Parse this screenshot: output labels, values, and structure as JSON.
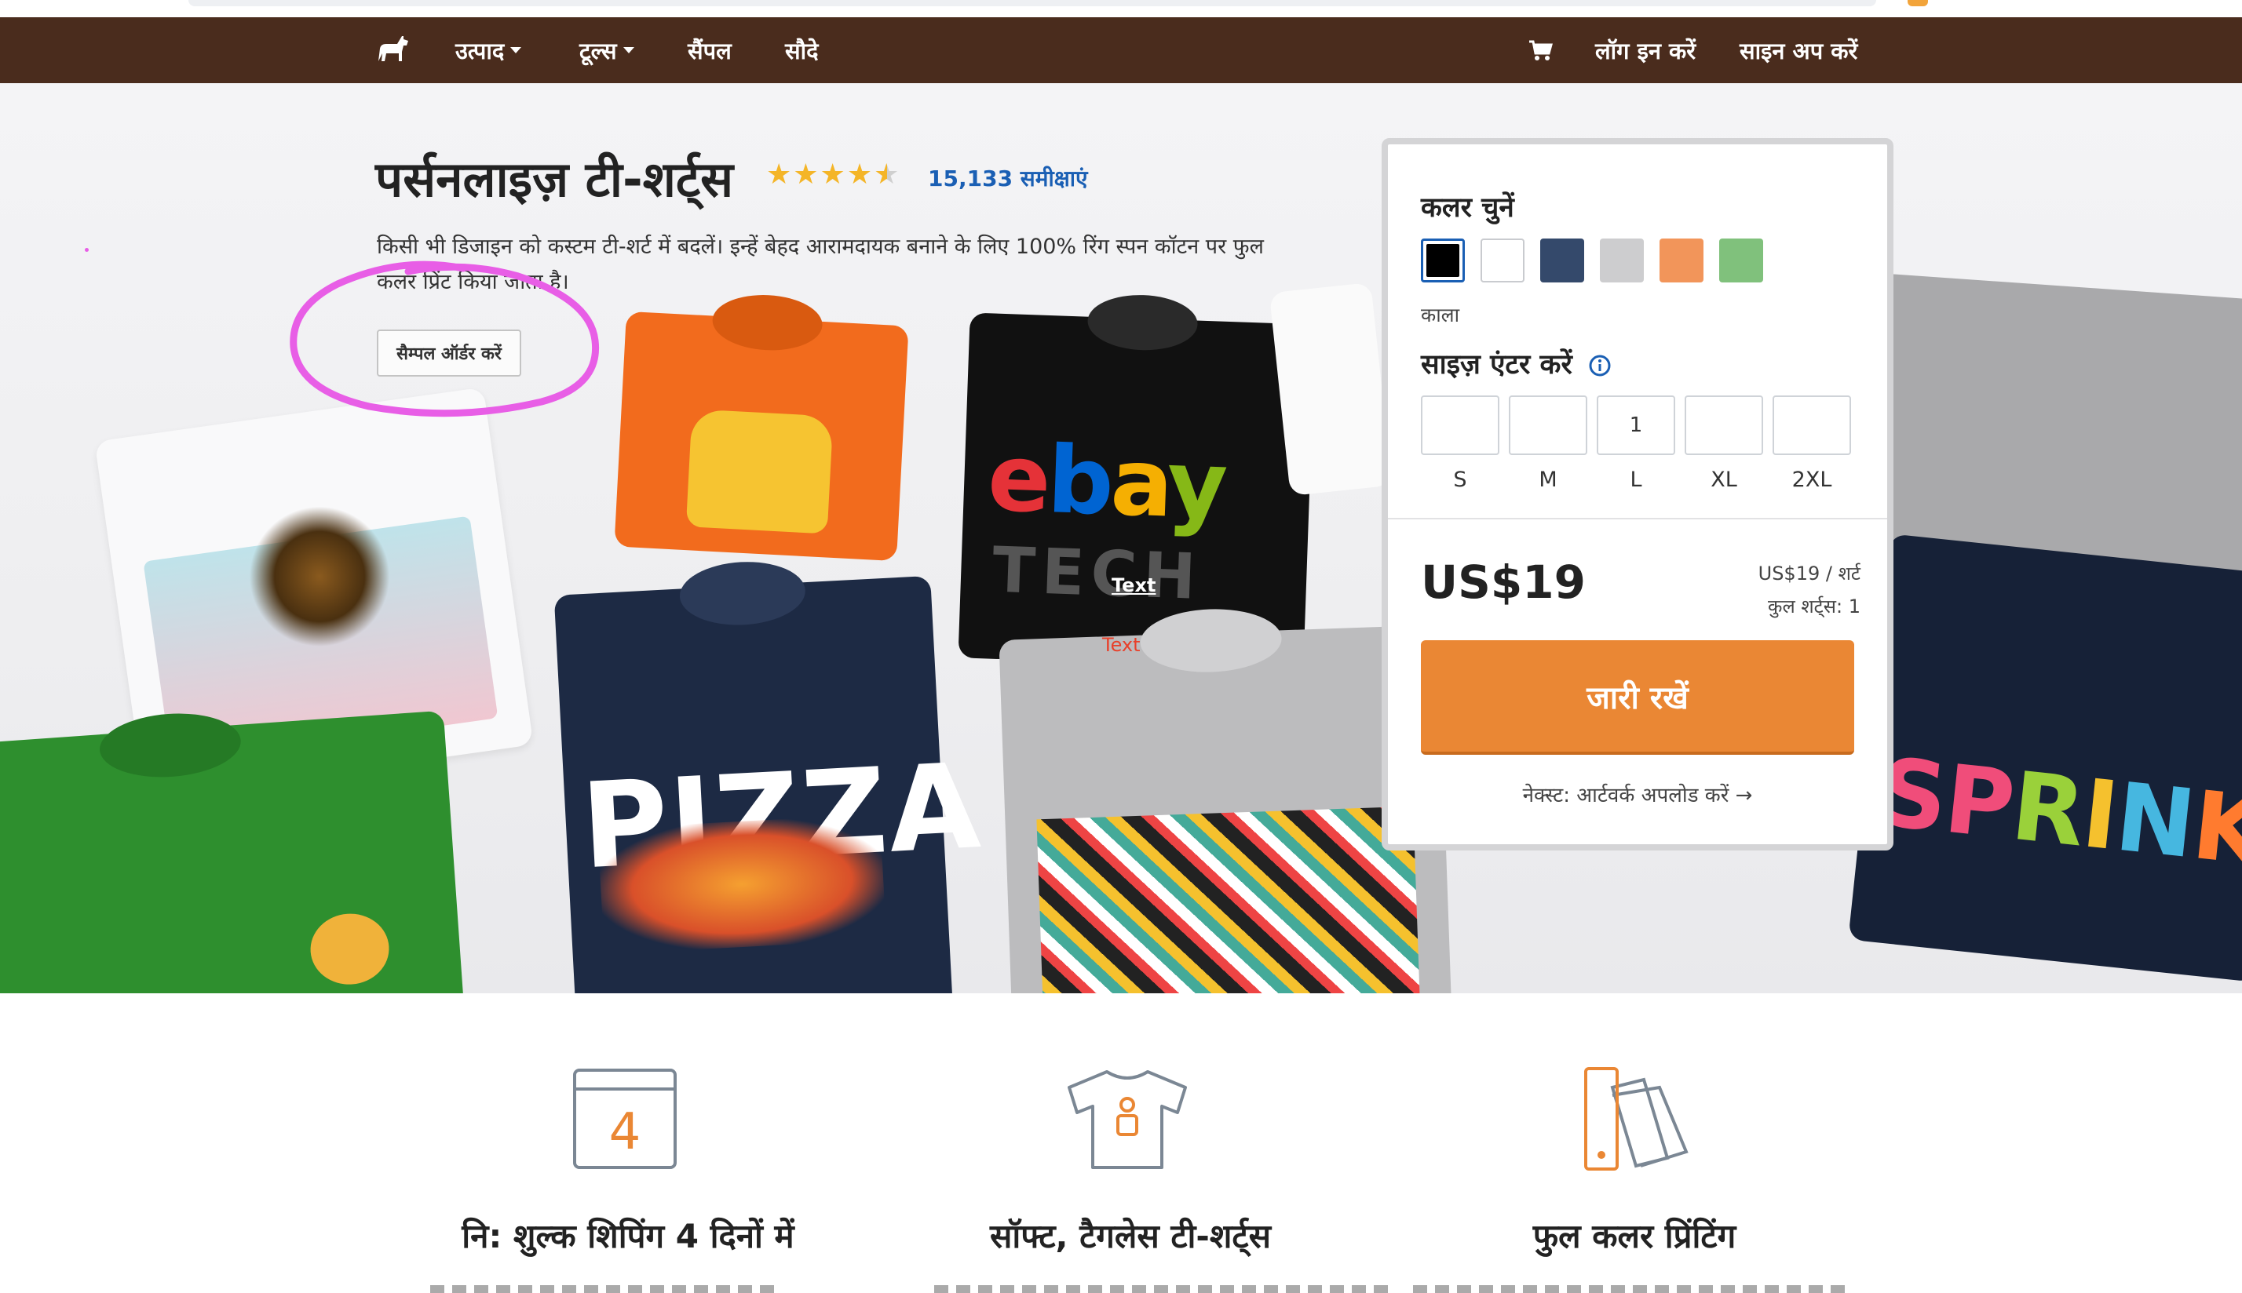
{
  "nav": {
    "items": [
      {
        "label": "उत्पाद",
        "dropdown": true
      },
      {
        "label": "टूल्स",
        "dropdown": true
      },
      {
        "label": "सैंपल",
        "dropdown": false
      },
      {
        "label": "सौदे",
        "dropdown": false
      }
    ],
    "login_label": "लॉग इन करें",
    "signup_label": "साइन अप करें"
  },
  "hero": {
    "title": "पर्सनलाइज़ टी-शर्ट्स",
    "rating": 4.5,
    "reviews_label": "15,133 समीक्षाएं",
    "description": "किसी भी डिजाइन को कस्टम टी-शर्ट में बदलें। इन्हें बेहद आरामदायक बनाने के लिए 100% रिंग स्पन कॉटन पर फुल कलर प्रिंट किया जाता है।",
    "sample_button": "सैम्पल ऑर्डर करें",
    "annotation_white": "Text",
    "annotation_red": "Text",
    "shirt_prints": [
      "ebay",
      "TECH",
      "PIZZA",
      "SPRINKL"
    ]
  },
  "order_panel": {
    "color_label": "कलर चुनें",
    "colors": [
      {
        "name": "black",
        "hex": "#000000",
        "selected": true
      },
      {
        "name": "white",
        "hex": "#ffffff",
        "selected": false
      },
      {
        "name": "navy",
        "hex": "#34496b",
        "selected": false
      },
      {
        "name": "gray",
        "hex": "#cdcdcf",
        "selected": false
      },
      {
        "name": "orange",
        "hex": "#f2955a",
        "selected": false
      },
      {
        "name": "green",
        "hex": "#80c17c",
        "selected": false
      }
    ],
    "selected_color_name": "काला",
    "size_label": "साइज़ एंटर करें",
    "sizes": [
      {
        "label": "S",
        "value": ""
      },
      {
        "label": "M",
        "value": ""
      },
      {
        "label": "L",
        "value": "1"
      },
      {
        "label": "XL",
        "value": ""
      },
      {
        "label": "2XL",
        "value": ""
      }
    ],
    "price": "US$19",
    "per_shirt": "US$19 / शर्ट",
    "total_shirts": "कुल शर्ट्स: 1",
    "cta_label": "जारी रखें",
    "next_text": "नेक्स्ट: आर्टवर्क अपलोड करें →"
  },
  "features": [
    {
      "title": "नि: शुल्क शिपिंग 4 दिनों में",
      "icon": "calendar-icon",
      "calendar_number": "4"
    },
    {
      "title": "सॉफ्ट, टैगलेस टी-शर्ट्स",
      "icon": "tshirt-icon"
    },
    {
      "title": "फुल कलर प्रिंटिंग",
      "icon": "color-swatch-icon"
    }
  ],
  "colors": {
    "nav_bg": "#4a2c1d",
    "cta": "#ea8734",
    "link": "#1a5fb4",
    "star": "#f4b528",
    "annotation_circle": "#e85ee6"
  }
}
